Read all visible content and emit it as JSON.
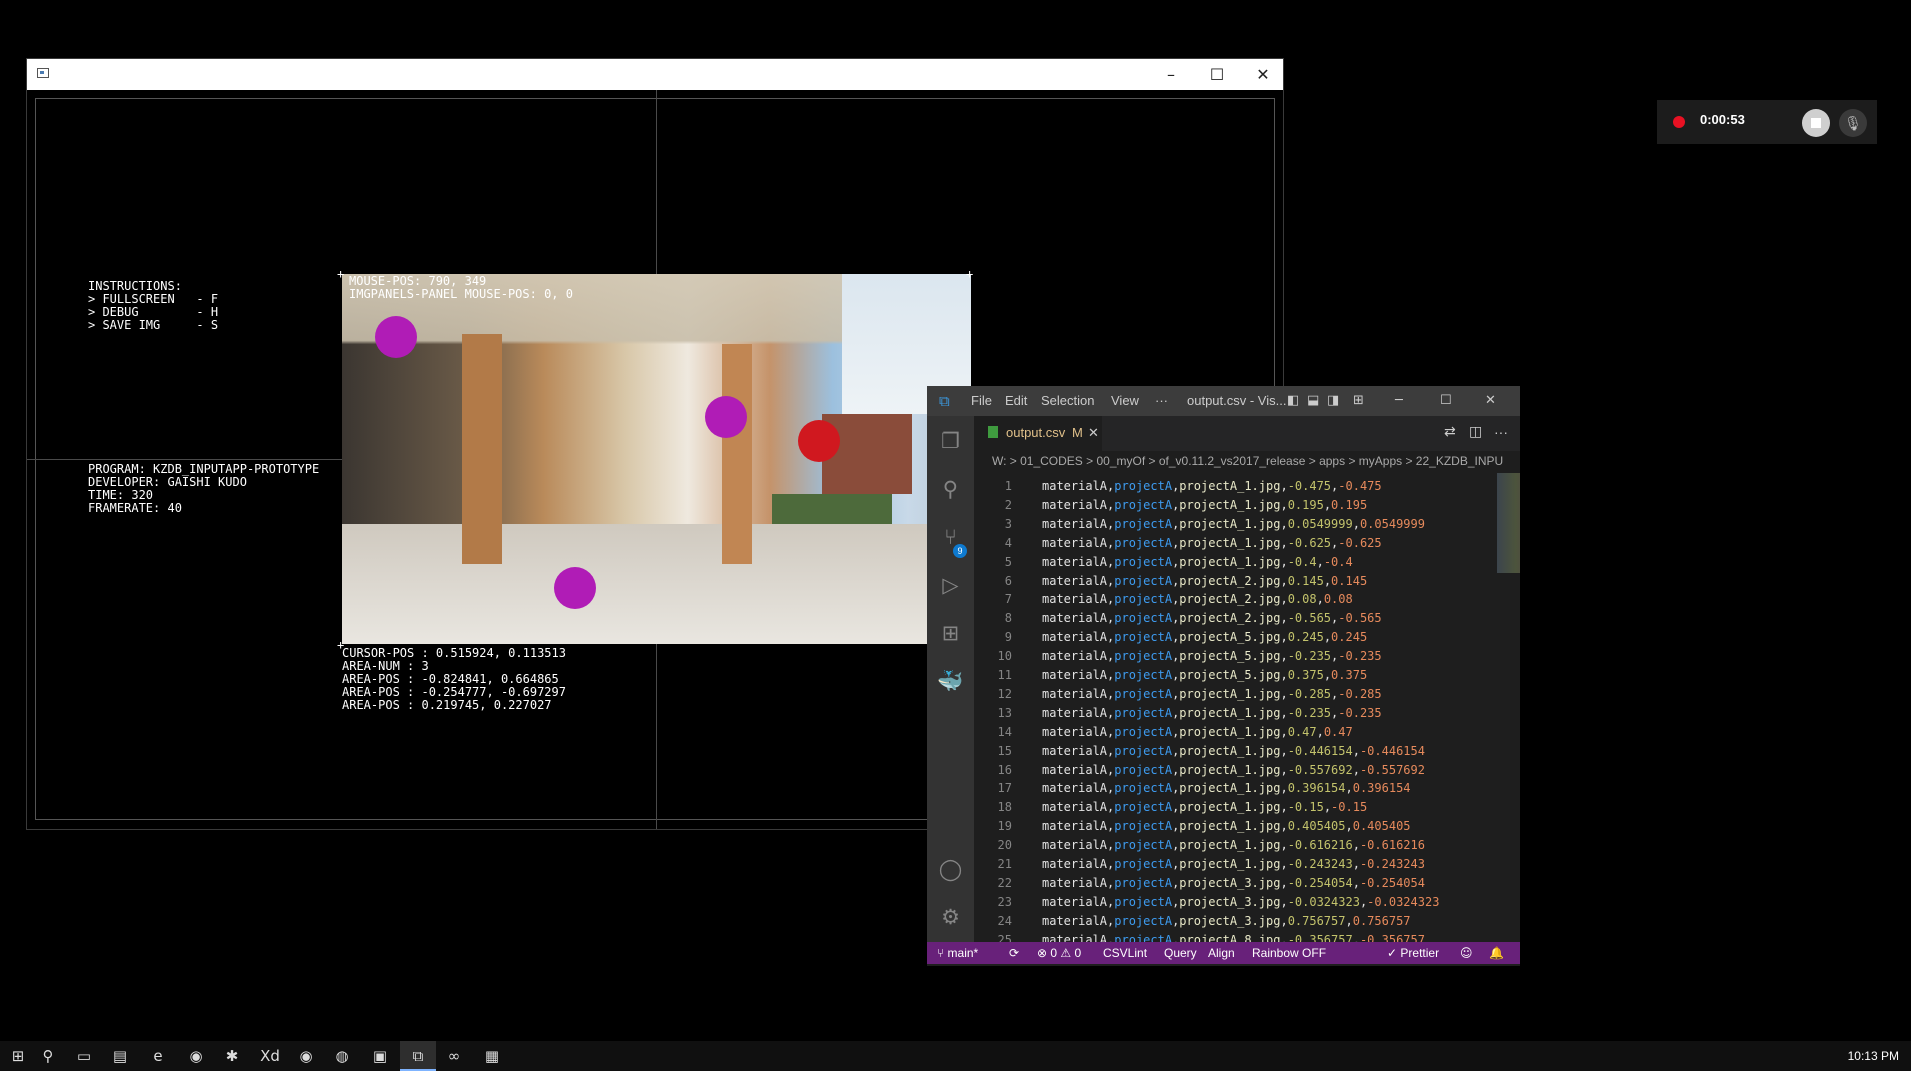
{
  "of_app": {
    "window_controls": {
      "minimize": "–",
      "maximize": "☐",
      "close": "✕"
    },
    "instructions": "INSTRUCTIONS:\n> FULLSCREEN   - F\n> DEBUG        - H\n> SAVE IMG     - S",
    "program_info": "PROGRAM: KZDB_INPUTAPP-PROTOTYPE\nDEVELOPER: GAISHI KUDO\nTIME: 320\nFRAMERATE: 40",
    "mouse_info": "MOUSE-POS: 790, 349\nIMGPANELS-PANEL MOUSE-POS: 0, 0",
    "cursor_info": "CURSOR-POS : 0.515924, 0.113513\nAREA-NUM : 3\nAREA-POS : -0.824841, 0.664865\nAREA-POS : -0.254777, -0.697297\nAREA-POS : 0.219745, 0.227027",
    "markers": [
      {
        "name": "marker-magenta-1",
        "color": "#b01cb6"
      },
      {
        "name": "marker-magenta-2",
        "color": "#b01cb6"
      },
      {
        "name": "marker-magenta-3",
        "color": "#b01cb6"
      },
      {
        "name": "marker-red",
        "color": "#d0181f"
      }
    ]
  },
  "recorder": {
    "time": "0:00:53",
    "stop_icon": "stop-icon",
    "mic_icon": "mic-off-icon"
  },
  "vscode": {
    "menu": [
      "File",
      "Edit",
      "Selection",
      "View",
      "···"
    ],
    "title": "output.csv - Vis...",
    "tab": {
      "label": "output.csv",
      "status": "M",
      "close": "✕"
    },
    "breadcrumb": "W: > 01_CODES > 00_myOf > of_v0.11.2_vs2017_release > apps > myApps > 22_KZDB_INPU",
    "source_control_badge": "9",
    "lines": [
      {
        "n": "1",
        "p1": "materialA",
        "p2": "projectA",
        "p3": "projectA_1.jpg",
        "p4": "-0.475",
        "p5": "-0.475"
      },
      {
        "n": "2",
        "p1": "materialA",
        "p2": "projectA",
        "p3": "projectA_1.jpg",
        "p4": "0.195",
        "p5": "0.195"
      },
      {
        "n": "3",
        "p1": "materialA",
        "p2": "projectA",
        "p3": "projectA_1.jpg",
        "p4": "0.0549999",
        "p5": "0.0549999"
      },
      {
        "n": "4",
        "p1": "materialA",
        "p2": "projectA",
        "p3": "projectA_1.jpg",
        "p4": "-0.625",
        "p5": "-0.625"
      },
      {
        "n": "5",
        "p1": "materialA",
        "p2": "projectA",
        "p3": "projectA_1.jpg",
        "p4": "-0.4",
        "p5": "-0.4"
      },
      {
        "n": "6",
        "p1": "materialA",
        "p2": "projectA",
        "p3": "projectA_2.jpg",
        "p4": "0.145",
        "p5": "0.145"
      },
      {
        "n": "7",
        "p1": "materialA",
        "p2": "projectA",
        "p3": "projectA_2.jpg",
        "p4": "0.08",
        "p5": "0.08"
      },
      {
        "n": "8",
        "p1": "materialA",
        "p2": "projectA",
        "p3": "projectA_2.jpg",
        "p4": "-0.565",
        "p5": "-0.565"
      },
      {
        "n": "9",
        "p1": "materialA",
        "p2": "projectA",
        "p3": "projectA_5.jpg",
        "p4": "0.245",
        "p5": "0.245"
      },
      {
        "n": "10",
        "p1": "materialA",
        "p2": "projectA",
        "p3": "projectA_5.jpg",
        "p4": "-0.235",
        "p5": "-0.235"
      },
      {
        "n": "11",
        "p1": "materialA",
        "p2": "projectA",
        "p3": "projectA_5.jpg",
        "p4": "0.375",
        "p5": "0.375"
      },
      {
        "n": "12",
        "p1": "materialA",
        "p2": "projectA",
        "p3": "projectA_1.jpg",
        "p4": "-0.285",
        "p5": "-0.285"
      },
      {
        "n": "13",
        "p1": "materialA",
        "p2": "projectA",
        "p3": "projectA_1.jpg",
        "p4": "-0.235",
        "p5": "-0.235"
      },
      {
        "n": "14",
        "p1": "materialA",
        "p2": "projectA",
        "p3": "projectA_1.jpg",
        "p4": "0.47",
        "p5": "0.47"
      },
      {
        "n": "15",
        "p1": "materialA",
        "p2": "projectA",
        "p3": "projectA_1.jpg",
        "p4": "-0.446154",
        "p5": "-0.446154"
      },
      {
        "n": "16",
        "p1": "materialA",
        "p2": "projectA",
        "p3": "projectA_1.jpg",
        "p4": "-0.557692",
        "p5": "-0.557692"
      },
      {
        "n": "17",
        "p1": "materialA",
        "p2": "projectA",
        "p3": "projectA_1.jpg",
        "p4": "0.396154",
        "p5": "0.396154"
      },
      {
        "n": "18",
        "p1": "materialA",
        "p2": "projectA",
        "p3": "projectA_1.jpg",
        "p4": "-0.15",
        "p5": "-0.15"
      },
      {
        "n": "19",
        "p1": "materialA",
        "p2": "projectA",
        "p3": "projectA_1.jpg",
        "p4": "0.405405",
        "p5": "0.405405"
      },
      {
        "n": "20",
        "p1": "materialA",
        "p2": "projectA",
        "p3": "projectA_1.jpg",
        "p4": "-0.616216",
        "p5": "-0.616216"
      },
      {
        "n": "21",
        "p1": "materialA",
        "p2": "projectA",
        "p3": "projectA_1.jpg",
        "p4": "-0.243243",
        "p5": "-0.243243"
      },
      {
        "n": "22",
        "p1": "materialA",
        "p2": "projectA",
        "p3": "projectA_3.jpg",
        "p4": "-0.254054",
        "p5": "-0.254054"
      },
      {
        "n": "23",
        "p1": "materialA",
        "p2": "projectA",
        "p3": "projectA_3.jpg",
        "p4": "-0.0324323",
        "p5": "-0.0324323"
      },
      {
        "n": "24",
        "p1": "materialA",
        "p2": "projectA",
        "p3": "projectA_3.jpg",
        "p4": "0.756757",
        "p5": "0.756757"
      },
      {
        "n": "25",
        "p1": "materialA",
        "p2": "projectA",
        "p3": "projectA_8.jpg",
        "p4": "-0.356757",
        "p5": "-0.356757"
      }
    ],
    "status": {
      "branch": "main*",
      "sync": "⟳",
      "problems": "⊗ 0 ⚠ 0",
      "csvlint": "CSVLint",
      "query": "Query",
      "align": "Align",
      "rainbow": "Rainbow OFF",
      "prettier": "✓ Prettier"
    }
  },
  "taskbar": {
    "icons": [
      "windows-start-icon",
      "search-icon",
      "task-view-icon",
      "file-explorer-icon",
      "edge-icon",
      "chrome-icon",
      "slack-icon",
      "adobe-xd-icon",
      "chrome-icon",
      "app-icon",
      "csv-app-icon",
      "vscode-icon",
      "visual-studio-icon",
      "of-app-icon"
    ],
    "labels": [
      "⊞",
      "⚲",
      "▭",
      "▤",
      "e",
      "◉",
      "✱",
      "Xd",
      "◉",
      "◍",
      "▣",
      "⧉",
      "∞",
      "▦"
    ],
    "clock": "10:13 PM"
  }
}
